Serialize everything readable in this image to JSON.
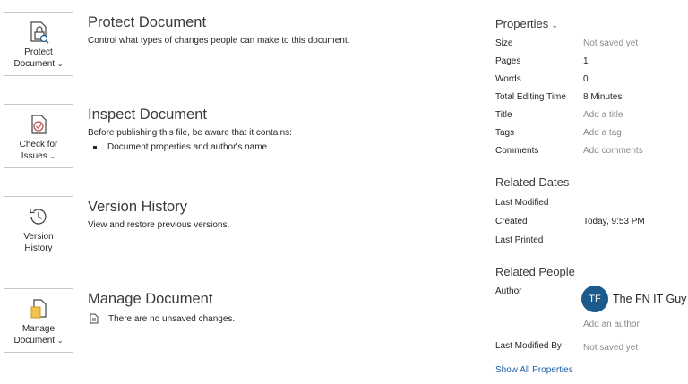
{
  "sections": {
    "protect": {
      "button_line1": "Protect",
      "button_line2": "Document",
      "title": "Protect Document",
      "description": "Control what types of changes people can make to this document.",
      "icon": "lock-document-icon"
    },
    "inspect": {
      "button_line1": "Check for",
      "button_line2": "Issues",
      "title": "Inspect Document",
      "description": "Before publishing this file, be aware that it contains:",
      "bullets": [
        "Document properties and author's name"
      ],
      "icon": "inspect-document-icon"
    },
    "history": {
      "button_line1": "Version",
      "button_line2": "History",
      "title": "Version History",
      "description": "View and restore previous versions.",
      "icon": "history-clock-icon"
    },
    "manage": {
      "button_line1": "Manage",
      "button_line2": "Document",
      "title": "Manage Document",
      "status": "There are no unsaved changes.",
      "icon": "manage-document-icon"
    }
  },
  "properties": {
    "heading": "Properties",
    "rows": [
      {
        "label": "Size",
        "value": "Not saved yet"
      },
      {
        "label": "Pages",
        "value": "1"
      },
      {
        "label": "Words",
        "value": "0"
      },
      {
        "label": "Total Editing Time",
        "value": "8 Minutes"
      },
      {
        "label": "Title",
        "value": "Add a title"
      },
      {
        "label": "Tags",
        "value": "Add a tag"
      },
      {
        "label": "Comments",
        "value": "Add comments"
      }
    ]
  },
  "related_dates": {
    "heading": "Related Dates",
    "rows": [
      {
        "label": "Last Modified",
        "value": ""
      },
      {
        "label": "Created",
        "value": "Today, 9:53 PM"
      },
      {
        "label": "Last Printed",
        "value": ""
      }
    ]
  },
  "related_people": {
    "heading": "Related People",
    "author_label": "Author",
    "author_initials": "TF",
    "author_name": "The FN IT Guy",
    "add_author": "Add an author",
    "last_modified_by_label": "Last Modified By",
    "last_modified_by_value": "Not saved yet"
  },
  "show_all_properties": "Show All Properties",
  "colors": {
    "accent": "#1d5a8c",
    "link": "#1a5ea8",
    "muted": "#8a8a8a"
  }
}
